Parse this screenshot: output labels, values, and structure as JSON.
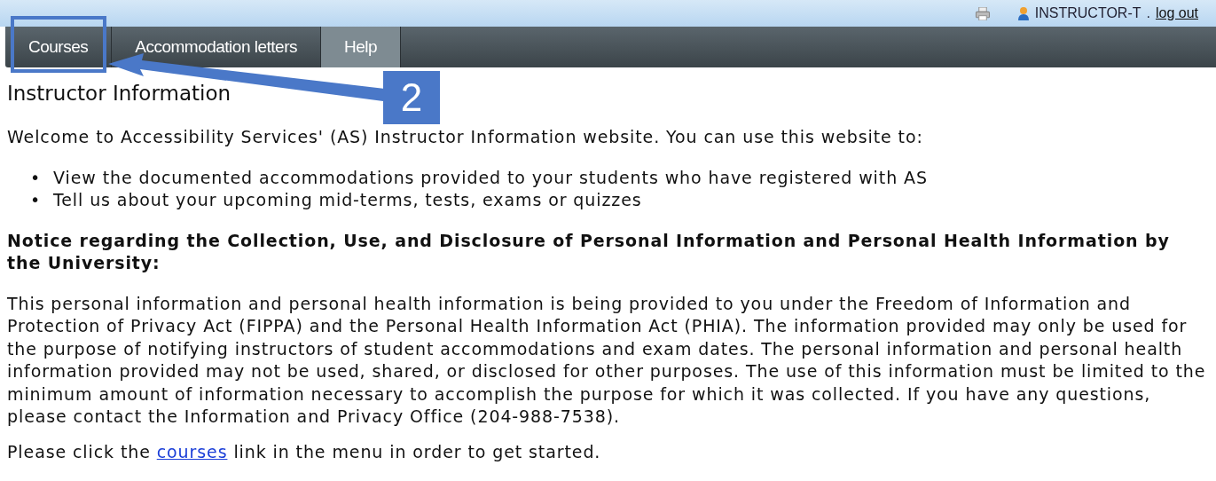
{
  "top_bar": {
    "user": "INSTRUCTOR-T",
    "separator": ".",
    "logout": "log out"
  },
  "tabs": [
    {
      "label": "Courses",
      "selected": false
    },
    {
      "label": "Accommodation letters",
      "selected": false
    },
    {
      "label": "Help",
      "selected": true
    }
  ],
  "annotation": {
    "step": "2"
  },
  "heading": "Instructor Information",
  "intro": "Welcome to Accessibility Services' (AS) Instructor Information website. You can use this website to:",
  "bullets": [
    {
      "marker": "•",
      "text": "View the documented accommodations provided to your students who have registered with AS"
    },
    {
      "marker": "•",
      "text": "Tell us about your upcoming mid-terms, tests, exams or quizzes"
    }
  ],
  "notice_title": "Notice regarding the Collection, Use, and Disclosure of Personal Information and Personal Health Information by the University:",
  "notice_body": "This personal information and personal health information is being provided to you under the Freedom of Information and Protection of Privacy Act (FIPPA) and the Personal Health Information Act (PHIA). The information provided may only be used for the purpose of notifying instructors of student accommodations and exam dates. The personal information and personal health information provided may not be used, shared, or disclosed for other purposes. The use of this information must be limited to the minimum amount of information necessary to accomplish the purpose for which it was collected. If you have any questions, please contact the Information and Privacy Office (204-988-7538).",
  "closing": {
    "before": "Please click the",
    "link": "courses",
    "after": "link in the menu in order to get started."
  }
}
